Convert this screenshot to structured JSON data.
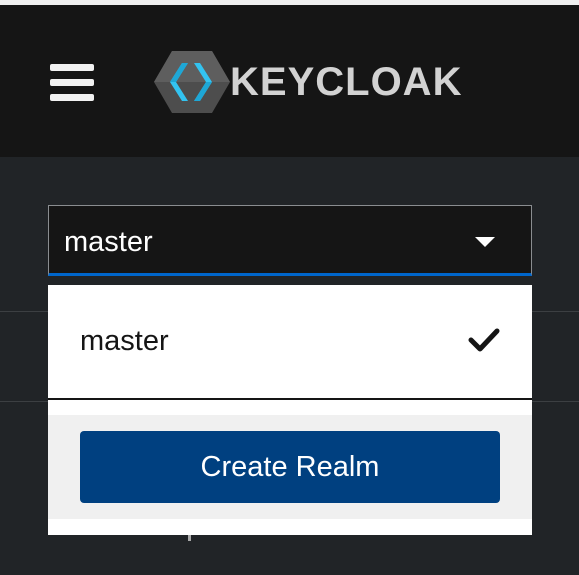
{
  "header": {
    "logo_text": "KEYCLOAK",
    "menu_icon": "hamburger-menu-icon"
  },
  "realm_selector": {
    "selected": "master",
    "caret_icon": "caret-down-icon"
  },
  "realm_menu": {
    "items": [
      {
        "label": "master",
        "selected": true,
        "icon": "checkmark-icon"
      }
    ],
    "create_button_label": "Create Realm"
  },
  "colors": {
    "header_bg": "#151515",
    "page_bg": "#212427",
    "accent_underline": "#0066cc",
    "primary_button": "#004080",
    "logo_blue": "#33c3f0",
    "logo_gray": "#d2d2d2"
  }
}
